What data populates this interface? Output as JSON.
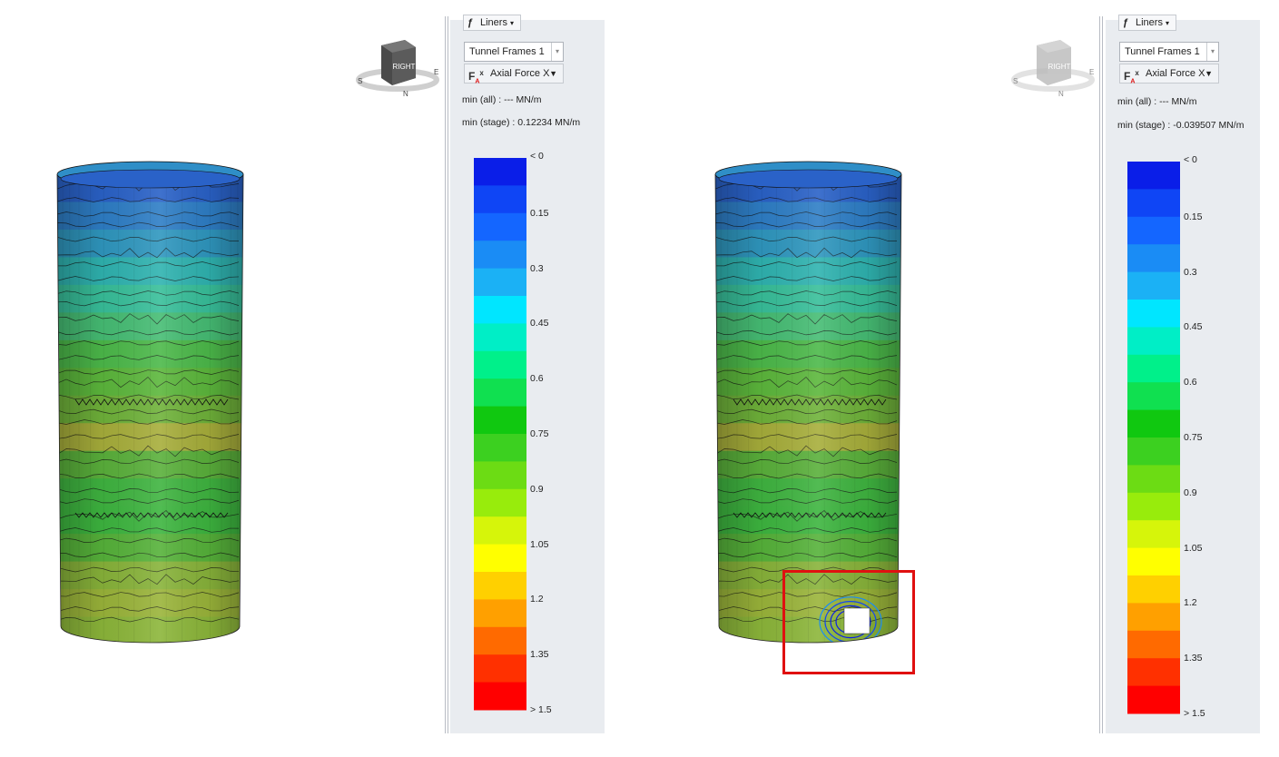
{
  "left_view": {
    "nav_cube": {
      "face_label": "RIGHT",
      "ring_letters": [
        "S",
        "E",
        "N"
      ]
    },
    "panel": {
      "toolbar_button": "Liners",
      "frame_selector": "Tunnel Frames 1",
      "result_selector": "Axial Force X",
      "min_all": "min (all) :       --- MN/m",
      "min_stage": "min (stage) : 0.12234 MN/m"
    },
    "legend": {
      "labels": [
        "< 0",
        "0.15",
        "0.3",
        "0.45",
        "0.6",
        "0.75",
        "0.9",
        "1.05",
        "1.2",
        "1.35",
        "> 1.5"
      ],
      "colors": [
        "#0a1ee8",
        "#0f45f5",
        "#1466ff",
        "#1a8cf5",
        "#1bb1f5",
        "#00e6ff",
        "#00eec6",
        "#00f08a",
        "#10e050",
        "#10c810",
        "#3cd020",
        "#6cdc14",
        "#98ec0c",
        "#d6f50a",
        "#ffff00",
        "#ffd000",
        "#ffa000",
        "#ff6a00",
        "#ff3000",
        "#ff0000"
      ]
    }
  },
  "right_view": {
    "nav_cube": {
      "face_label": "RIGHT",
      "ring_letters": [
        "S",
        "E",
        "N"
      ]
    },
    "panel": {
      "toolbar_button": "Liners",
      "frame_selector": "Tunnel Frames 1",
      "result_selector": "Axial Force X",
      "min_all": "min (all) :       --- MN/m",
      "min_stage": "min (stage) : -0.039507 MN/m"
    },
    "legend": {
      "labels": [
        "< 0",
        "0.15",
        "0.3",
        "0.45",
        "0.6",
        "0.75",
        "0.9",
        "1.05",
        "1.2",
        "1.35",
        "> 1.5"
      ],
      "colors": [
        "#0a1ee8",
        "#0f45f5",
        "#1466ff",
        "#1a8cf5",
        "#1bb1f5",
        "#00e6ff",
        "#00eec6",
        "#00f08a",
        "#10e050",
        "#10c810",
        "#3cd020",
        "#6cdc14",
        "#98ec0c",
        "#d6f50a",
        "#ffff00",
        "#ffd000",
        "#ffa000",
        "#ff6a00",
        "#ff3000",
        "#ff0000"
      ]
    },
    "highlight_color": "#e01010"
  },
  "shaft_colors": {
    "bands": [
      "#2a62c8",
      "#2e7ec6",
      "#2f97bf",
      "#2fb3b0",
      "#38bf9a",
      "#46bd74",
      "#4cb94a",
      "#5cb73c",
      "#6fb23a",
      "#a7ae3b",
      "#5ab03b",
      "#3fb440",
      "#3db53f",
      "#56b23a",
      "#88b33a",
      "#9ab43a",
      "#8cb63a"
    ]
  },
  "icons": {
    "toolbar": "liner-icon",
    "result": "force-x-icon"
  }
}
